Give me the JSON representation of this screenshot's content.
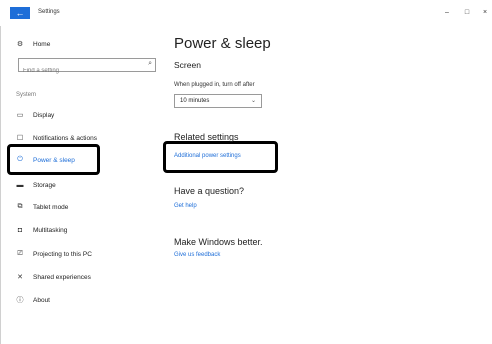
{
  "window": {
    "title": "Settings",
    "back_icon": "←",
    "minimize_glyph": "–",
    "maximize_glyph": "□",
    "close_glyph": "×"
  },
  "sidebar": {
    "home_label": "Home",
    "search_placeholder": "Find a setting",
    "section_label": "System",
    "items": [
      {
        "label": "Display",
        "icon": "display-icon"
      },
      {
        "label": "Notifications & actions",
        "icon": "notifications-icon"
      },
      {
        "label": "Power & sleep",
        "icon": "power-icon",
        "selected": true
      },
      {
        "label": "Storage",
        "icon": "storage-icon"
      },
      {
        "label": "Tablet mode",
        "icon": "tablet-icon"
      },
      {
        "label": "Multitasking",
        "icon": "multitasking-icon"
      },
      {
        "label": "Projecting to this PC",
        "icon": "projecting-icon"
      },
      {
        "label": "Shared experiences",
        "icon": "shared-icon"
      },
      {
        "label": "About",
        "icon": "info-icon"
      }
    ]
  },
  "main": {
    "title": "Power & sleep",
    "screen_heading": "Screen",
    "plugged_in_label": "When plugged in, turn off after",
    "plugged_in_value": "10 minutes",
    "related_heading": "Related settings",
    "additional_power_link": "Additional power settings",
    "question_heading": "Have a question?",
    "get_help_link": "Get help",
    "better_heading": "Make Windows better.",
    "feedback_link": "Give us feedback"
  },
  "colors": {
    "accent": "#1e6ed8",
    "highlight_border": "#000000"
  }
}
